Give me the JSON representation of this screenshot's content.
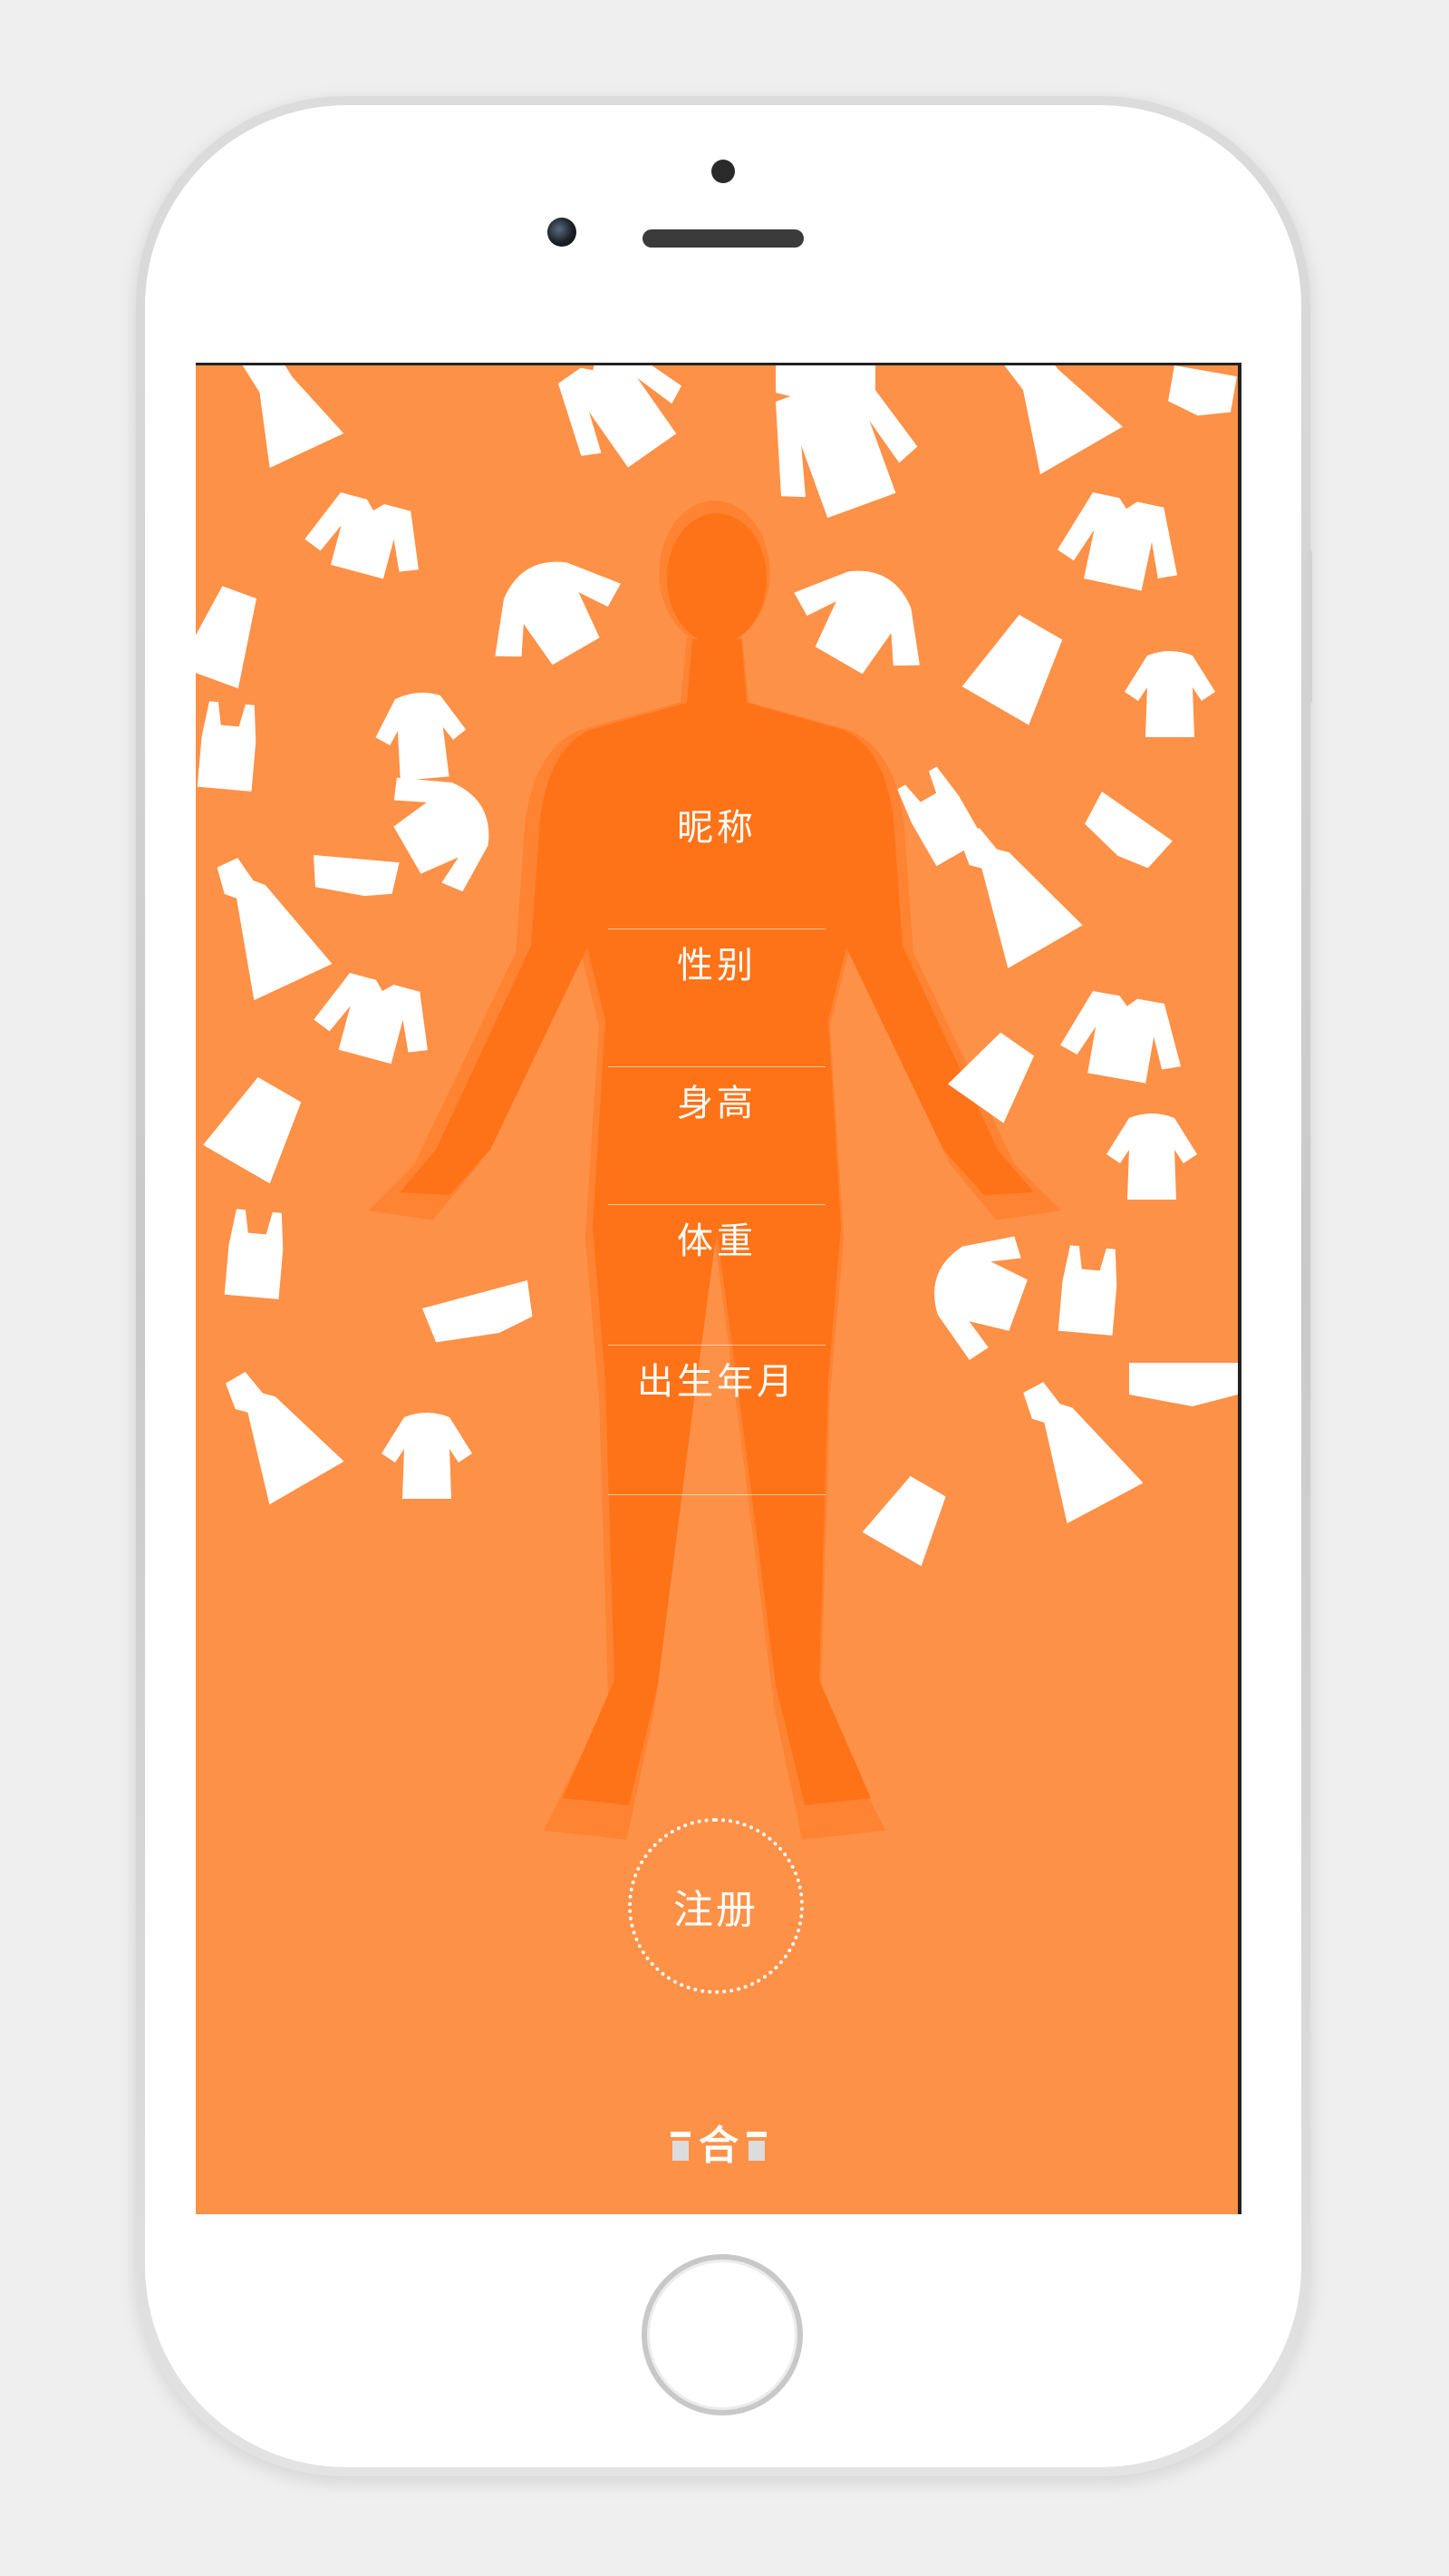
{
  "menu": {
    "items": [
      {
        "label": "昵称"
      },
      {
        "label": "性别"
      },
      {
        "label": "身高"
      },
      {
        "label": "体重"
      },
      {
        "label": "出生年月"
      }
    ]
  },
  "register": {
    "label": "注册"
  },
  "logo": {
    "text": "合"
  },
  "colors": {
    "background": "#fe9148",
    "figure": "#fe7318",
    "clothing": "#ffffff"
  },
  "icons": [
    "body-silhouette-icon",
    "clothing-icons",
    "app-logo-icon"
  ]
}
